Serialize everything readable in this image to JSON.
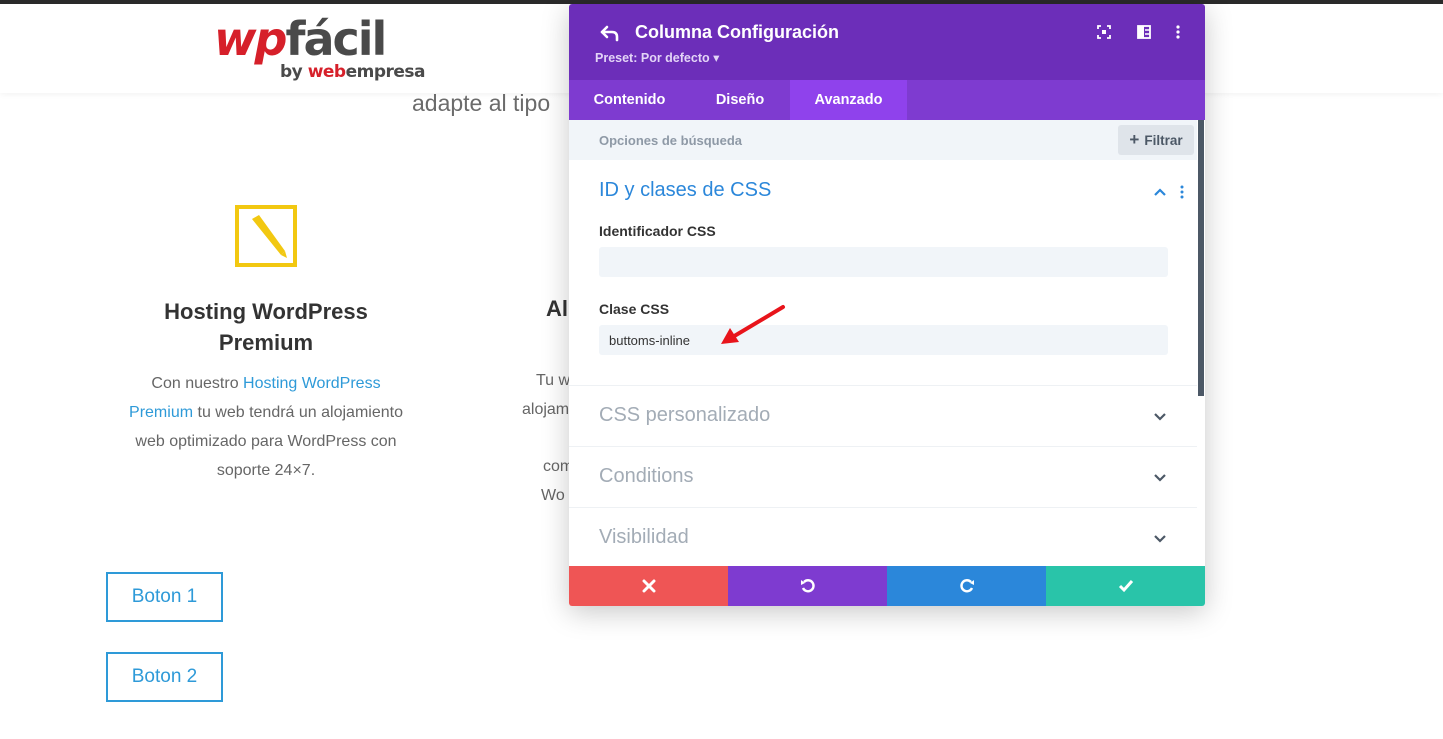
{
  "site": {
    "logo_wp": "wp",
    "logo_facil": "fácil",
    "logo_by": "by",
    "logo_web": "web",
    "logo_empresa": "empresa",
    "intro_text": "adapte al tipo",
    "col1": {
      "title": "Hosting WordPress Premium",
      "body_pre": "Con nuestro",
      "body_link": "Hosting WordPress Premium",
      "body_post": "tu web tendrá un alojamiento web optimizado para WordPress con soporte 24×7."
    },
    "col2": {
      "title_partial": "Al",
      "lines": [
        "Tu w",
        "alojam",
        "",
        "com",
        "Wo",
        "",
        ""
      ]
    },
    "buttons": [
      "Boton 1",
      "Boton 2"
    ]
  },
  "panel": {
    "title": "Columna Configuración",
    "preset": "Preset: Por defecto ▾",
    "tabs": [
      {
        "label": "Contenido",
        "active": false
      },
      {
        "label": "Diseño",
        "active": false
      },
      {
        "label": "Avanzado",
        "active": true
      }
    ],
    "search_placeholder": "Opciones de búsqueda",
    "filter_label": "Filtrar",
    "sections": {
      "css_id_classes": {
        "title": "ID y clases de CSS",
        "id_label": "Identificador CSS",
        "id_value": "",
        "class_label": "Clase CSS",
        "class_value": "buttoms-inline"
      },
      "collapsed": [
        "CSS personalizado",
        "Conditions",
        "Visibilidad"
      ]
    },
    "footer_colors": {
      "cancel": "#ef5555",
      "undo": "#7e3bd0",
      "redo": "#2b87da",
      "save": "#29c4a9"
    }
  },
  "colors": {
    "header_purple": "#6c2eb9",
    "tabs_purple": "#7e3bd0",
    "accent_blue": "#2b87da",
    "link_blue": "#2e9ad8",
    "annotation_red": "#e8141b",
    "icon_yellow": "#f2c811"
  }
}
